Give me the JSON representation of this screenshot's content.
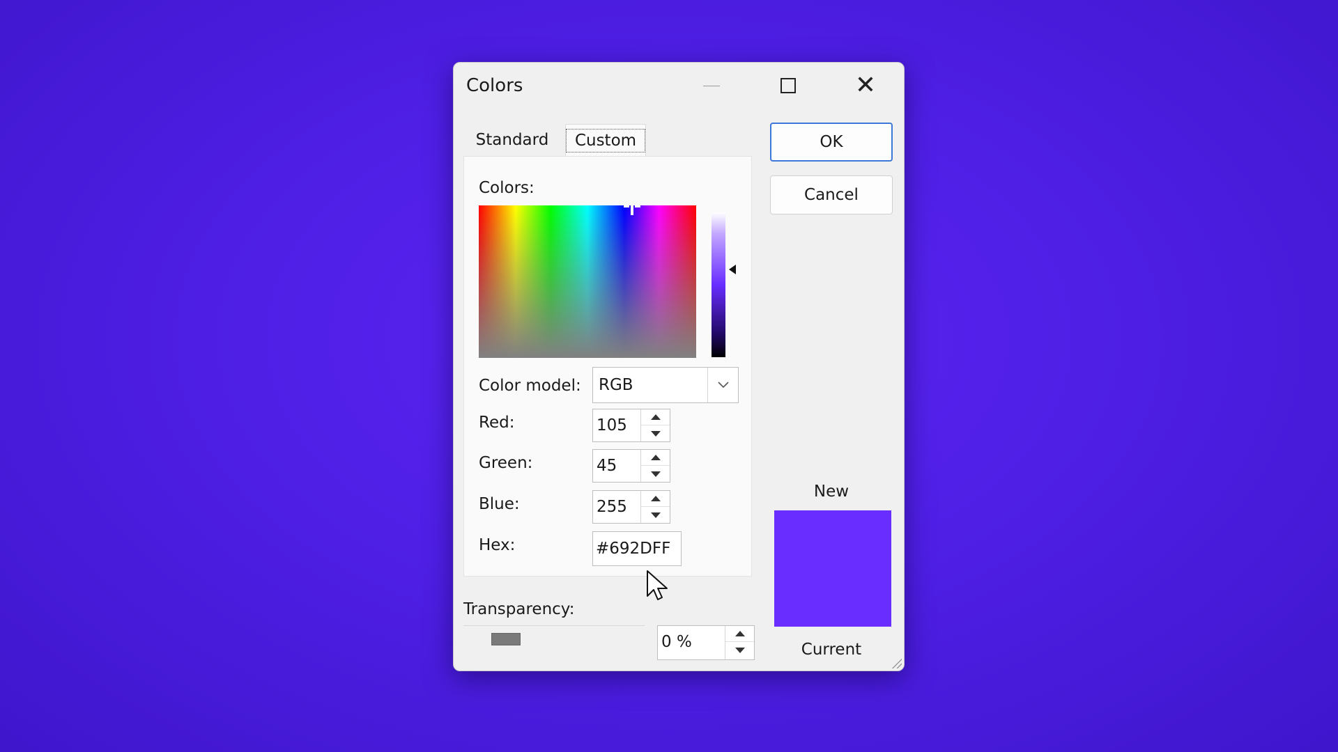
{
  "dialog": {
    "title": "Colors",
    "tabs": [
      "Standard",
      "Custom"
    ],
    "active_tab": "Custom"
  },
  "buttons": {
    "ok": "OK",
    "cancel": "Cancel"
  },
  "custom": {
    "colors_label": "Colors:",
    "color_model_label": "Color model:",
    "color_model_value": "RGB",
    "red_label": "Red:",
    "red_value": "105",
    "green_label": "Green:",
    "green_value": "45",
    "blue_label": "Blue:",
    "blue_value": "255",
    "hex_label": "Hex:",
    "hex_value": "#692DFF"
  },
  "transparency": {
    "label": "Transparency:",
    "value": "0 %"
  },
  "preview": {
    "new_label": "New",
    "current_label": "Current",
    "color": "#692DFF"
  },
  "icons": [
    "minimize-icon",
    "maximize-icon",
    "close-icon",
    "chevron-down-icon",
    "spin-up-icon",
    "spin-down-icon",
    "mouse-pointer-icon"
  ]
}
